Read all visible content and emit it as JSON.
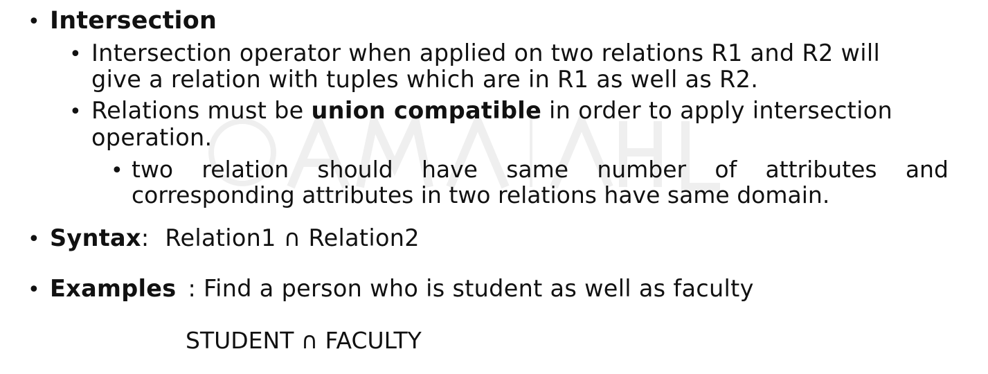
{
  "section": {
    "heading": "Intersection",
    "points": [
      {
        "line1": "Intersection operator when applied on two relations R1 and R2 will",
        "line2": "give a relation with tuples which are in R1 as well as R2."
      },
      {
        "pre": "Relations must be ",
        "bold": "union compatible",
        "post": " in order to apply intersection",
        "line2": "operation.",
        "sub": {
          "line1_words": [
            "two",
            "relation",
            "should",
            "have",
            "same",
            "number",
            "of",
            "attributes",
            "and"
          ],
          "line2": "corresponding attributes in two relations have same domain."
        }
      }
    ]
  },
  "syntax": {
    "label": "Syntax",
    "colon": ":",
    "expression": "Relation1 ∩ Relation2"
  },
  "examples": {
    "label": "Examples",
    "text": " : Find a person who is student as well as faculty",
    "expression": "STUDENT ∩ FACULTY"
  },
  "bullet_char": "•"
}
